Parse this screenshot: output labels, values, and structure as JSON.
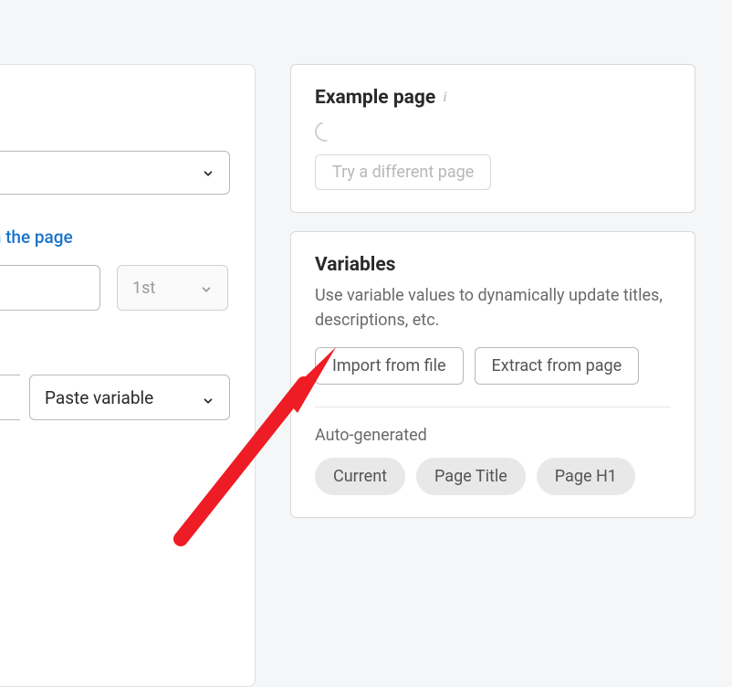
{
  "left": {
    "link_text": "on the page",
    "ordinal_value": "1st",
    "paste_variable_label": "Paste variable"
  },
  "example_page": {
    "title": "Example page",
    "try_button": "Try a different page"
  },
  "variables": {
    "title": "Variables",
    "description": "Use variable values to dynamically update titles, descriptions, etc.",
    "import_button": "Import from file",
    "extract_button": "Extract from page",
    "auto_label": "Auto-generated",
    "pills": [
      "Current",
      "Page Title",
      "Page H1"
    ]
  }
}
